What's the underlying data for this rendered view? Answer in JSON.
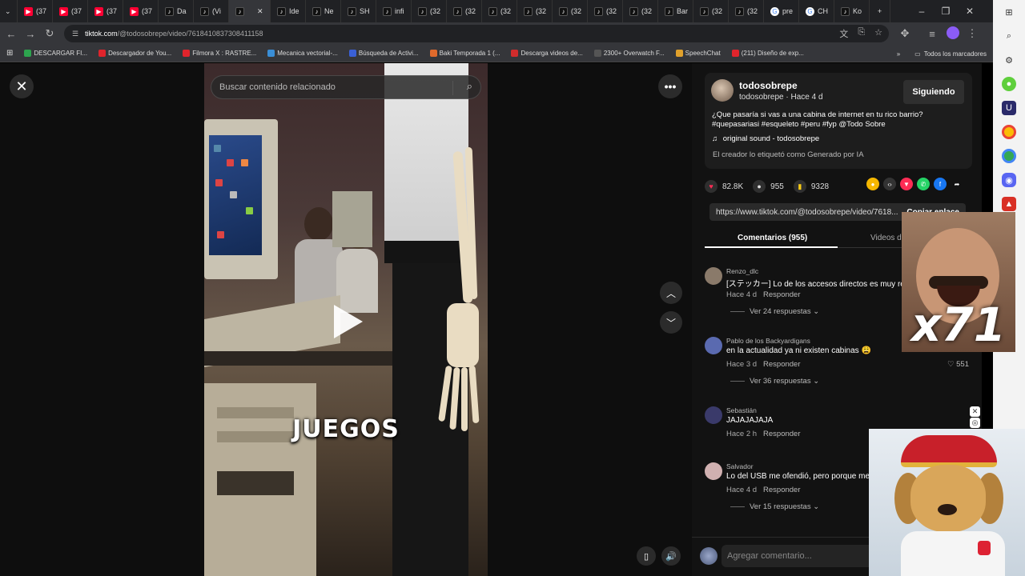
{
  "browser": {
    "tabs": [
      {
        "label": "(37",
        "favicon": "youtube-icon"
      },
      {
        "label": "(37",
        "favicon": "youtube-icon"
      },
      {
        "label": "(37",
        "favicon": "youtube-icon"
      },
      {
        "label": "(37",
        "favicon": "youtube-icon"
      },
      {
        "label": "Da",
        "favicon": "tiktok-icon"
      },
      {
        "label": "(Vi",
        "favicon": "tiktok-icon"
      },
      {
        "label": "",
        "favicon": "tiktok-icon",
        "active": true
      },
      {
        "label": "Ide",
        "favicon": "tiktok-icon"
      },
      {
        "label": "Ne",
        "favicon": "tiktok-icon"
      },
      {
        "label": "SH",
        "favicon": "tiktok-icon"
      },
      {
        "label": "infi",
        "favicon": "tiktok-icon"
      },
      {
        "label": "(32",
        "favicon": "tiktok-icon"
      },
      {
        "label": "(32",
        "favicon": "tiktok-icon"
      },
      {
        "label": "(32",
        "favicon": "tiktok-icon"
      },
      {
        "label": "(32",
        "favicon": "tiktok-icon"
      },
      {
        "label": "(32",
        "favicon": "tiktok-icon"
      },
      {
        "label": "(32",
        "favicon": "tiktok-icon"
      },
      {
        "label": "(32",
        "favicon": "tiktok-icon"
      },
      {
        "label": "Bar",
        "favicon": "tiktok-icon"
      },
      {
        "label": "(32",
        "favicon": "tiktok-icon"
      },
      {
        "label": "(32",
        "favicon": "tiktok-icon"
      },
      {
        "label": "pre",
        "favicon": "google-icon"
      },
      {
        "label": "CH",
        "favicon": "google-icon"
      },
      {
        "label": "Ko",
        "favicon": "tiktok-icon"
      }
    ],
    "url_host": "tiktok.com",
    "url_path": "/@todosobrepe/video/7618410837308411158",
    "bookmarks": [
      {
        "label": "DESCARGAR FI...",
        "color": "#2da44e"
      },
      {
        "label": "Descargador de You...",
        "color": "#e0242c"
      },
      {
        "label": "Filmora X : RASTRE...",
        "color": "#e0242c"
      },
      {
        "label": "Mecanica vectorial-...",
        "color": "#3a8ed6"
      },
      {
        "label": "Búsqueda de Activi...",
        "color": "#3a60d6"
      },
      {
        "label": "Baki Temporada 1 (...",
        "color": "#e06a2c"
      },
      {
        "label": "Descarga videos de...",
        "color": "#d02c2c"
      },
      {
        "label": "2300+ Overwatch F...",
        "color": "#555555"
      },
      {
        "label": "SpeechChat",
        "color": "#e0a12c"
      },
      {
        "label": "(211) Diseño de exp...",
        "color": "#e0242c"
      }
    ],
    "all_bookmarks": "Todos los marcadores"
  },
  "video": {
    "search_placeholder": "Buscar contenido relacionado",
    "caption": "JUEGOS"
  },
  "panel": {
    "username": "todosobrepe",
    "subline": "todosobrepe · Hace 4 d",
    "follow_label": "Siguiendo",
    "description_line1": "¿Que pasaría si vas a una cabina de internet en tu rico barrio?",
    "description_line2": "#quepasariasi #esqueleto #peru #fyp @Todo Sobre",
    "sound": "original sound - todosobrepe",
    "ai_note": "El creador lo etiquetó como Generado por IA",
    "likes": "82.8K",
    "comments_count": "955",
    "saves": "9328",
    "link": "https://www.tiktok.com/@todosobrepe/video/7618...",
    "copy_link": "Copiar enlace",
    "tab_comments": "Comentarios (955)",
    "tab_videos": "Videos del creador",
    "comments": [
      {
        "name": "Renzo_dlc",
        "text": "[ステッカー] Lo de los accesos directos es muy real",
        "time": "Hace 4 d",
        "reply": "Responder",
        "replies": "Ver 24 respuestas",
        "avatar_color": "#8a7a6a"
      },
      {
        "name": "Pablo de los Backyardigans",
        "text": "en la actualidad ya ni existen cabinas 😩",
        "time": "Hace 3 d",
        "reply": "Responder",
        "likes": "♡ 551",
        "replies": "Ver 36 respuestas",
        "avatar_color": "#5a6ab0"
      },
      {
        "name": "Sebastián",
        "text": "JAJAJAJAJA",
        "time": "Hace 2 h",
        "reply": "Responder",
        "avatar_color": "#3a3a6a"
      },
      {
        "name": "Salvador",
        "text": "Lo del USB me ofendió, pero porque me pasó",
        "time": "Hace 4 d",
        "reply": "Responder",
        "replies": "Ver 15 respuestas",
        "avatar_color": "#d0b0b0"
      }
    ],
    "comment_placeholder": "Agregar comentario..."
  },
  "overlays": {
    "meme_text": "x71"
  }
}
